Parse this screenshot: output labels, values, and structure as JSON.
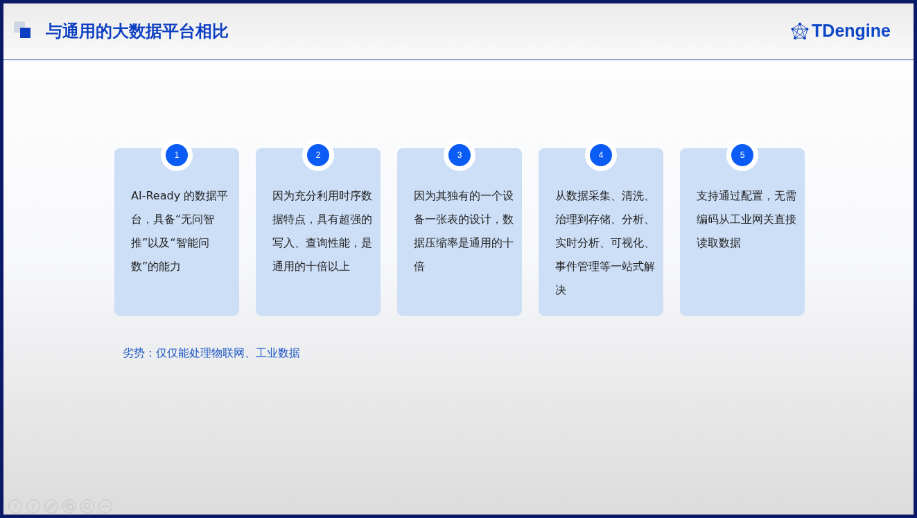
{
  "slide": {
    "title": "与通用的大数据平台相比",
    "logo_text": "TDengine",
    "cards": [
      {
        "number": "1",
        "text": "AI-Ready 的数据平台，具备“无问智推”以及“智能问数”的能力"
      },
      {
        "number": "2",
        "text": "因为充分利用时序数据特点，具有超强的写入、查询性能，是通用的十倍以上"
      },
      {
        "number": "3",
        "text": "因为其独有的一个设备一张表的设计，数据压缩率是通用的十倍"
      },
      {
        "number": "4",
        "text": "从数据采集、清洗、治理到存储、分析、实时分析、可视化、事件管理等一站式解决"
      },
      {
        "number": "5",
        "text": "支持通过配置，无需编码从工业网关直接读取数据"
      }
    ],
    "note": "劣势：仅仅能处理物联网、工业数据"
  }
}
